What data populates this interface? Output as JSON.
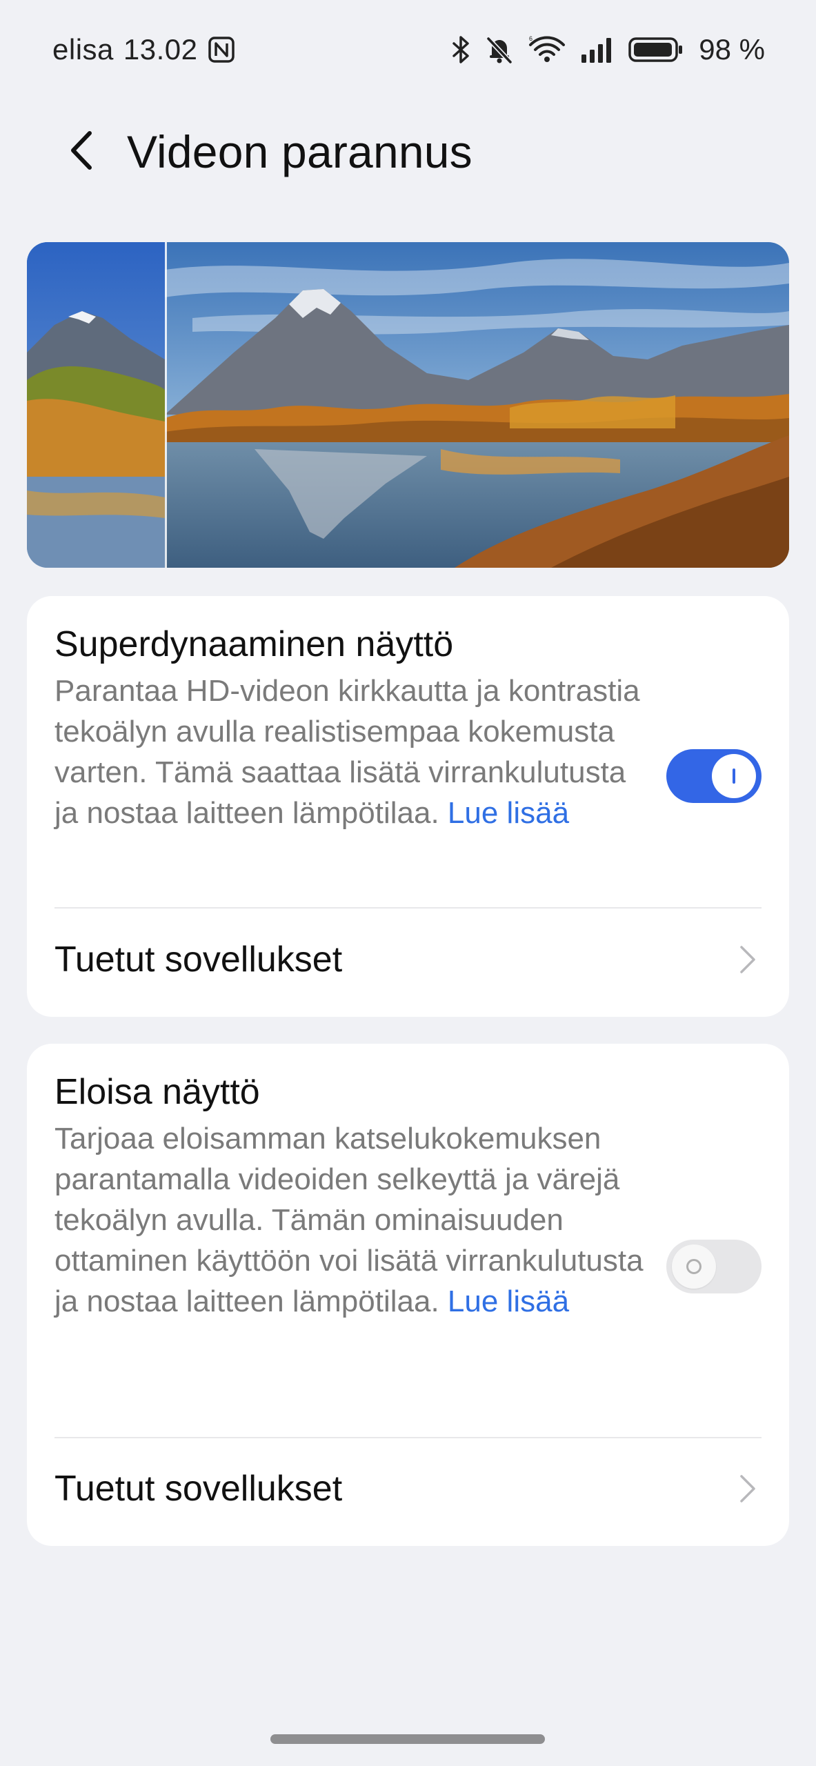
{
  "status_bar": {
    "carrier": "elisa",
    "time": "13.02",
    "battery_percent": "98 %",
    "icons": [
      "nfc-icon",
      "bluetooth-icon",
      "mute-bell-icon",
      "wifi-icon",
      "signal-icon",
      "battery-icon"
    ]
  },
  "header": {
    "title": "Videon parannus",
    "back_icon": "chevron-left-icon"
  },
  "banner": {
    "image": "mountain-lake-autumn-comparison"
  },
  "settings": [
    {
      "title": "Superdynaaminen näyttö",
      "description": "Parantaa HD-videon kirkkautta ja kontrastia tekoälyn avulla realistisempaa kokemusta varten. Tämä saattaa lisätä virrankulutusta ja nostaa laitteen lämpötilaa.",
      "learn_more": "Lue lisää",
      "enabled": true,
      "supported_apps_label": "Tuetut sovellukset"
    },
    {
      "title": "Eloisa näyttö",
      "description": "Tarjoaa eloisamman katselukokemuksen parantamalla videoiden selkeyttä ja värejä tekoälyn avulla. Tämän ominaisuuden ottaminen käyttöön voi lisätä virrankulutusta ja nostaa laitteen lämpötilaa.",
      "learn_more": "Lue lisää",
      "enabled": false,
      "supported_apps_label": "Tuetut sovellukset"
    }
  ],
  "colors": {
    "accent": "#3366e6",
    "link": "#2f6fe4",
    "background": "#f0f1f5",
    "card": "#ffffff"
  }
}
